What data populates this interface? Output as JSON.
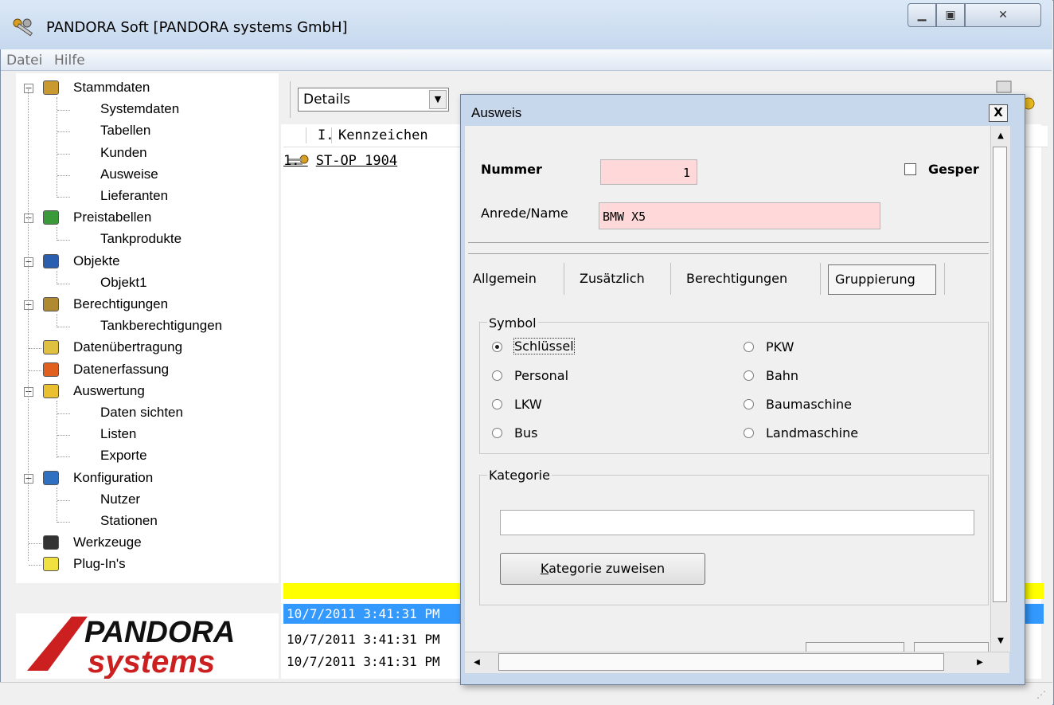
{
  "window": {
    "title": "PANDORA Soft [PANDORA systems GmbH]"
  },
  "menu": [
    {
      "label": "Datei"
    },
    {
      "label": "Hilfe"
    }
  ],
  "tree": {
    "nodes": [
      {
        "label": "Stammdaten",
        "level": 0,
        "icon": "folder-gear-icon",
        "toggle": "−"
      },
      {
        "label": "Systemdaten",
        "level": 1
      },
      {
        "label": "Tabellen",
        "level": 1
      },
      {
        "label": "Kunden",
        "level": 1
      },
      {
        "label": "Ausweise",
        "level": 1
      },
      {
        "label": "Lieferanten",
        "level": 1
      },
      {
        "label": "Preistabellen",
        "level": 0,
        "icon": "price-globe-icon",
        "toggle": "−"
      },
      {
        "label": "Tankprodukte",
        "level": 1
      },
      {
        "label": "Objekte",
        "level": 0,
        "icon": "building-icon",
        "toggle": "−"
      },
      {
        "label": "Objekt1",
        "level": 1
      },
      {
        "label": "Berechtigungen",
        "level": 0,
        "icon": "keys-icon",
        "toggle": "−"
      },
      {
        "label": "Tankberechtigungen",
        "level": 1
      },
      {
        "label": "Datenübertragung",
        "level": 0,
        "icon": "card-icon"
      },
      {
        "label": "Datenerfassung",
        "level": 0,
        "icon": "pencil-icon"
      },
      {
        "label": "Auswertung",
        "level": 0,
        "icon": "chart-icon",
        "toggle": "−"
      },
      {
        "label": "Daten sichten",
        "level": 1
      },
      {
        "label": "Listen",
        "level": 1
      },
      {
        "label": "Exporte",
        "level": 1
      },
      {
        "label": "Konfiguration",
        "level": 0,
        "icon": "computer-icon",
        "toggle": "−"
      },
      {
        "label": "Nutzer",
        "level": 1
      },
      {
        "label": "Stationen",
        "level": 1
      },
      {
        "label": "Werkzeuge",
        "level": 0,
        "icon": "floppy-icon"
      },
      {
        "label": "Plug-In's",
        "level": 0,
        "icon": "lightbulb-icon"
      }
    ]
  },
  "logo": {
    "line1": "PANDORA",
    "line2": "systems",
    "color": "#cc1f1f"
  },
  "list": {
    "view_select": "Details",
    "columns": [
      "I.",
      "Kennzeichen"
    ],
    "rows": [
      {
        "index": "1.",
        "kennzeichen": "ST-OP 1904"
      }
    ]
  },
  "log": {
    "rows": [
      {
        "text": "10/7/2011 3:41:31 PM",
        "selected": true
      },
      {
        "text": "10/7/2011 3:41:31 PM",
        "selected": false
      },
      {
        "text": "10/7/2011 3:41:31 PM",
        "selected": false
      }
    ]
  },
  "dialog": {
    "title": "Ausweis",
    "close_label": "X",
    "nummer_label": "Nummer",
    "nummer_value": "1",
    "gesperrt_label": "Gesper",
    "gesperrt_checked": false,
    "name_label": "Anrede/Name",
    "name_value": "BMW X5",
    "tabs": [
      "Allgemein",
      "Zusätzlich",
      "Berechtigungen",
      "Gruppierung"
    ],
    "active_tab": "Gruppierung",
    "symbol_group": "Symbol",
    "symbols": [
      {
        "label": "Schlüssel",
        "checked": true
      },
      {
        "label": "Personal",
        "checked": false
      },
      {
        "label": "LKW",
        "checked": false
      },
      {
        "label": "Bus",
        "checked": false
      },
      {
        "label": "PKW",
        "checked": false
      },
      {
        "label": "Bahn",
        "checked": false
      },
      {
        "label": "Baumaschine",
        "checked": false
      },
      {
        "label": "Landmaschine",
        "checked": false
      }
    ],
    "kategorie_group": "Kategorie",
    "kategorie_value": "",
    "kategorie_button": "Kategorie zuweisen"
  },
  "colors": {
    "field_required": "#ffd9d9",
    "selection": "#3399ff",
    "highlight_bar": "#ffff00"
  }
}
